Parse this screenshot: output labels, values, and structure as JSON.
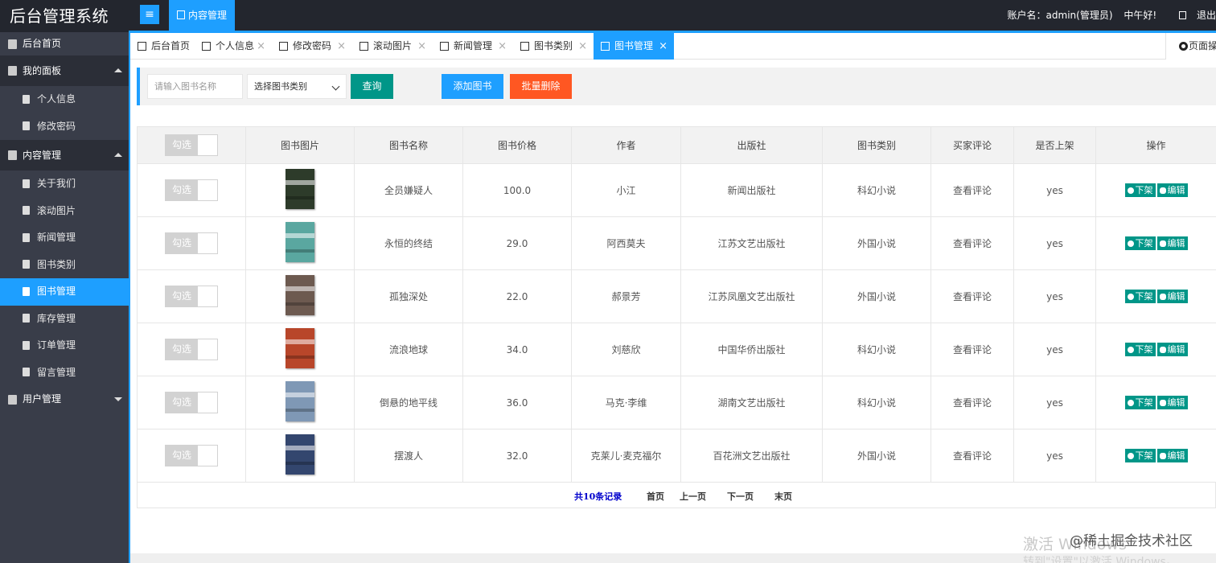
{
  "header": {
    "brand": "后台管理系统",
    "menu_icon": "menu-icon",
    "top_tab": "内容管理",
    "account": "账户名：admin(管理员)",
    "greeting": "中午好!",
    "logout": "退出"
  },
  "sidebar": {
    "home": "后台首页",
    "panel": "我的面板",
    "profile": "个人信息",
    "password": "修改密码",
    "content": "内容管理",
    "about": "关于我们",
    "carousel": "滚动图片",
    "news": "新闻管理",
    "book_category": "图书类别",
    "book_manage": "图书管理",
    "stock": "库存管理",
    "orders": "订单管理",
    "messages": "留言管理",
    "users": "用户管理"
  },
  "tabs": {
    "home": "后台首页",
    "profile": "个人信息",
    "password": "修改密码",
    "carousel": "滚动图片",
    "news": "新闻管理",
    "category": "图书类别",
    "books": "图书管理",
    "page_ops": "页面操作",
    "close": "×"
  },
  "toolbar": {
    "name_placeholder": "请输入图书名称",
    "category_select": "选择图书类别",
    "query": "查询",
    "add": "添加图书",
    "batch_delete": "批量删除"
  },
  "table": {
    "headers": [
      "勾选",
      "图书图片",
      "图书名称",
      "图书价格",
      "作者",
      "出版社",
      "图书类别",
      "买家评论",
      "是否上架",
      "操作"
    ],
    "check_label": "勾选",
    "review_link": "查看评论",
    "off_shelf": "下架",
    "edit": "编辑",
    "rows": [
      {
        "name": "全员嫌疑人",
        "price": "100.0",
        "author": "小江",
        "publisher": "新闻出版社",
        "category": "科幻小说",
        "listed": "yes",
        "cover": "#2d3b2a"
      },
      {
        "name": "永恒的终结",
        "price": "29.0",
        "author": "阿西莫夫",
        "publisher": "江苏文艺出版社",
        "category": "外国小说",
        "listed": "yes",
        "cover": "#5aa7a0"
      },
      {
        "name": "孤独深处",
        "price": "22.0",
        "author": "郝景芳",
        "publisher": "江苏凤凰文艺出版社",
        "category": "外国小说",
        "listed": "yes",
        "cover": "#6d5a50"
      },
      {
        "name": "流浪地球",
        "price": "34.0",
        "author": "刘慈欣",
        "publisher": "中国华侨出版社",
        "category": "科幻小说",
        "listed": "yes",
        "cover": "#b8462a"
      },
      {
        "name": "倒悬的地平线",
        "price": "36.0",
        "author": "马克·李维",
        "publisher": "湖南文艺出版社",
        "category": "科幻小说",
        "listed": "yes",
        "cover": "#7f98b5"
      },
      {
        "name": "摆渡人",
        "price": "32.0",
        "author": "克莱儿·麦克福尔",
        "publisher": "百花洲文艺出版社",
        "category": "外国小说",
        "listed": "yes",
        "cover": "#33466e"
      }
    ]
  },
  "pager": {
    "total": "共10条记录",
    "first": "首页",
    "prev": "上一页",
    "next": "下一页",
    "last": "末页"
  },
  "watermark": {
    "activate": "激活 Windows",
    "goto": "转到\"设置\"以激活 Windows。",
    "community": "@稀土掘金技术社区"
  }
}
